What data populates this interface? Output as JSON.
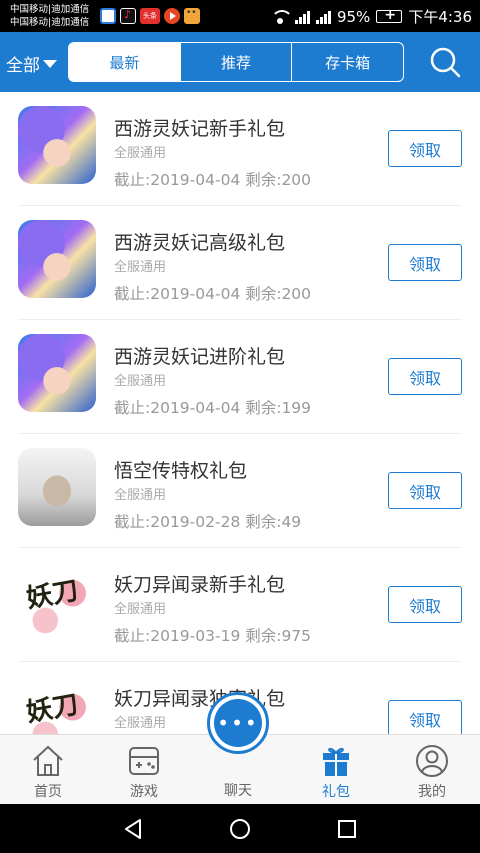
{
  "status_bar": {
    "carrier_line1": "中国移动|迪加通信",
    "carrier_line2": "中国移动|迪加通信",
    "app3_label": "头条",
    "battery": "95%",
    "time": "下午4:36"
  },
  "header": {
    "filter_label": "全部",
    "tabs": [
      {
        "label": "最新",
        "active": true
      },
      {
        "label": "推荐",
        "active": false
      },
      {
        "label": "存卡箱",
        "active": false
      }
    ],
    "accent_color": "#1e7cd0"
  },
  "gifts": [
    {
      "title": "西游灵妖记新手礼包",
      "scope": "全服通用",
      "meta": "截止:2019-04-04 剩余:200",
      "button": "领取",
      "icon": "xiyou-lingyao-icon"
    },
    {
      "title": "西游灵妖记高级礼包",
      "scope": "全服通用",
      "meta": "截止:2019-04-04 剩余:200",
      "button": "领取",
      "icon": "xiyou-lingyao-icon"
    },
    {
      "title": "西游灵妖记进阶礼包",
      "scope": "全服通用",
      "meta": "截止:2019-04-04 剩余:199",
      "button": "领取",
      "icon": "xiyou-lingyao-icon"
    },
    {
      "title": "悟空传特权礼包",
      "scope": "全服通用",
      "meta": "截止:2019-02-28 剩余:49",
      "button": "领取",
      "icon": "wukong-zhuan-icon"
    },
    {
      "title": "妖刀异闻录新手礼包",
      "scope": "全服通用",
      "meta": "截止:2019-03-19 剩余:975",
      "button": "领取",
      "icon": "yaodao-yiwenlu-icon"
    },
    {
      "title": "妖刀异闻录独家礼包",
      "scope": "全服通用",
      "meta": "",
      "button": "领取",
      "icon": "yaodao-yiwenlu-icon"
    }
  ],
  "bottom_nav": {
    "items": [
      {
        "label": "首页",
        "icon": "home-icon",
        "active": false
      },
      {
        "label": "游戏",
        "icon": "gamepad-icon",
        "active": false
      },
      {
        "label": "聊天",
        "icon": "chat-icon",
        "active": false
      },
      {
        "label": "礼包",
        "icon": "gift-icon",
        "active": true
      },
      {
        "label": "我的",
        "icon": "user-icon",
        "active": false
      }
    ],
    "chat_glyph": "•••"
  }
}
